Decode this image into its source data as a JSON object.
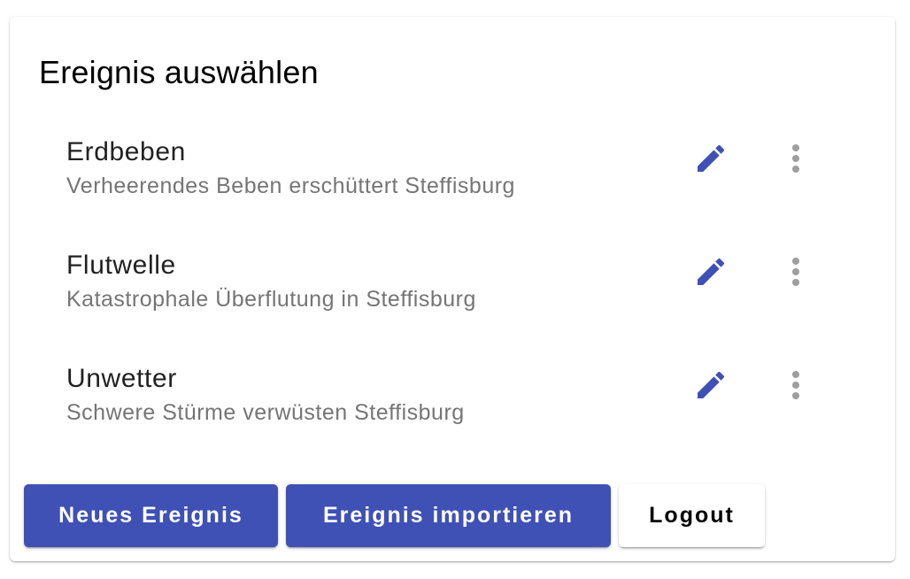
{
  "card": {
    "title": "Ereignis auswählen"
  },
  "events": [
    {
      "title": "Erdbeben",
      "subtitle": "Verheerendes Beben erschüttert Steffisburg"
    },
    {
      "title": "Flutwelle",
      "subtitle": "Katastrophale Überflutung in Steffisburg"
    },
    {
      "title": "Unwetter",
      "subtitle": "Schwere Stürme verwüsten Steffisburg"
    }
  ],
  "icons": {
    "edit": "pencil-icon",
    "more": "more-vert-icon"
  },
  "actions": {
    "new_label": "Neues Ereignis",
    "import_label": "Ereignis importieren",
    "logout_label": "Logout"
  },
  "colors": {
    "primary": "#3f51b5",
    "icon_grey": "#9e9e9e"
  }
}
